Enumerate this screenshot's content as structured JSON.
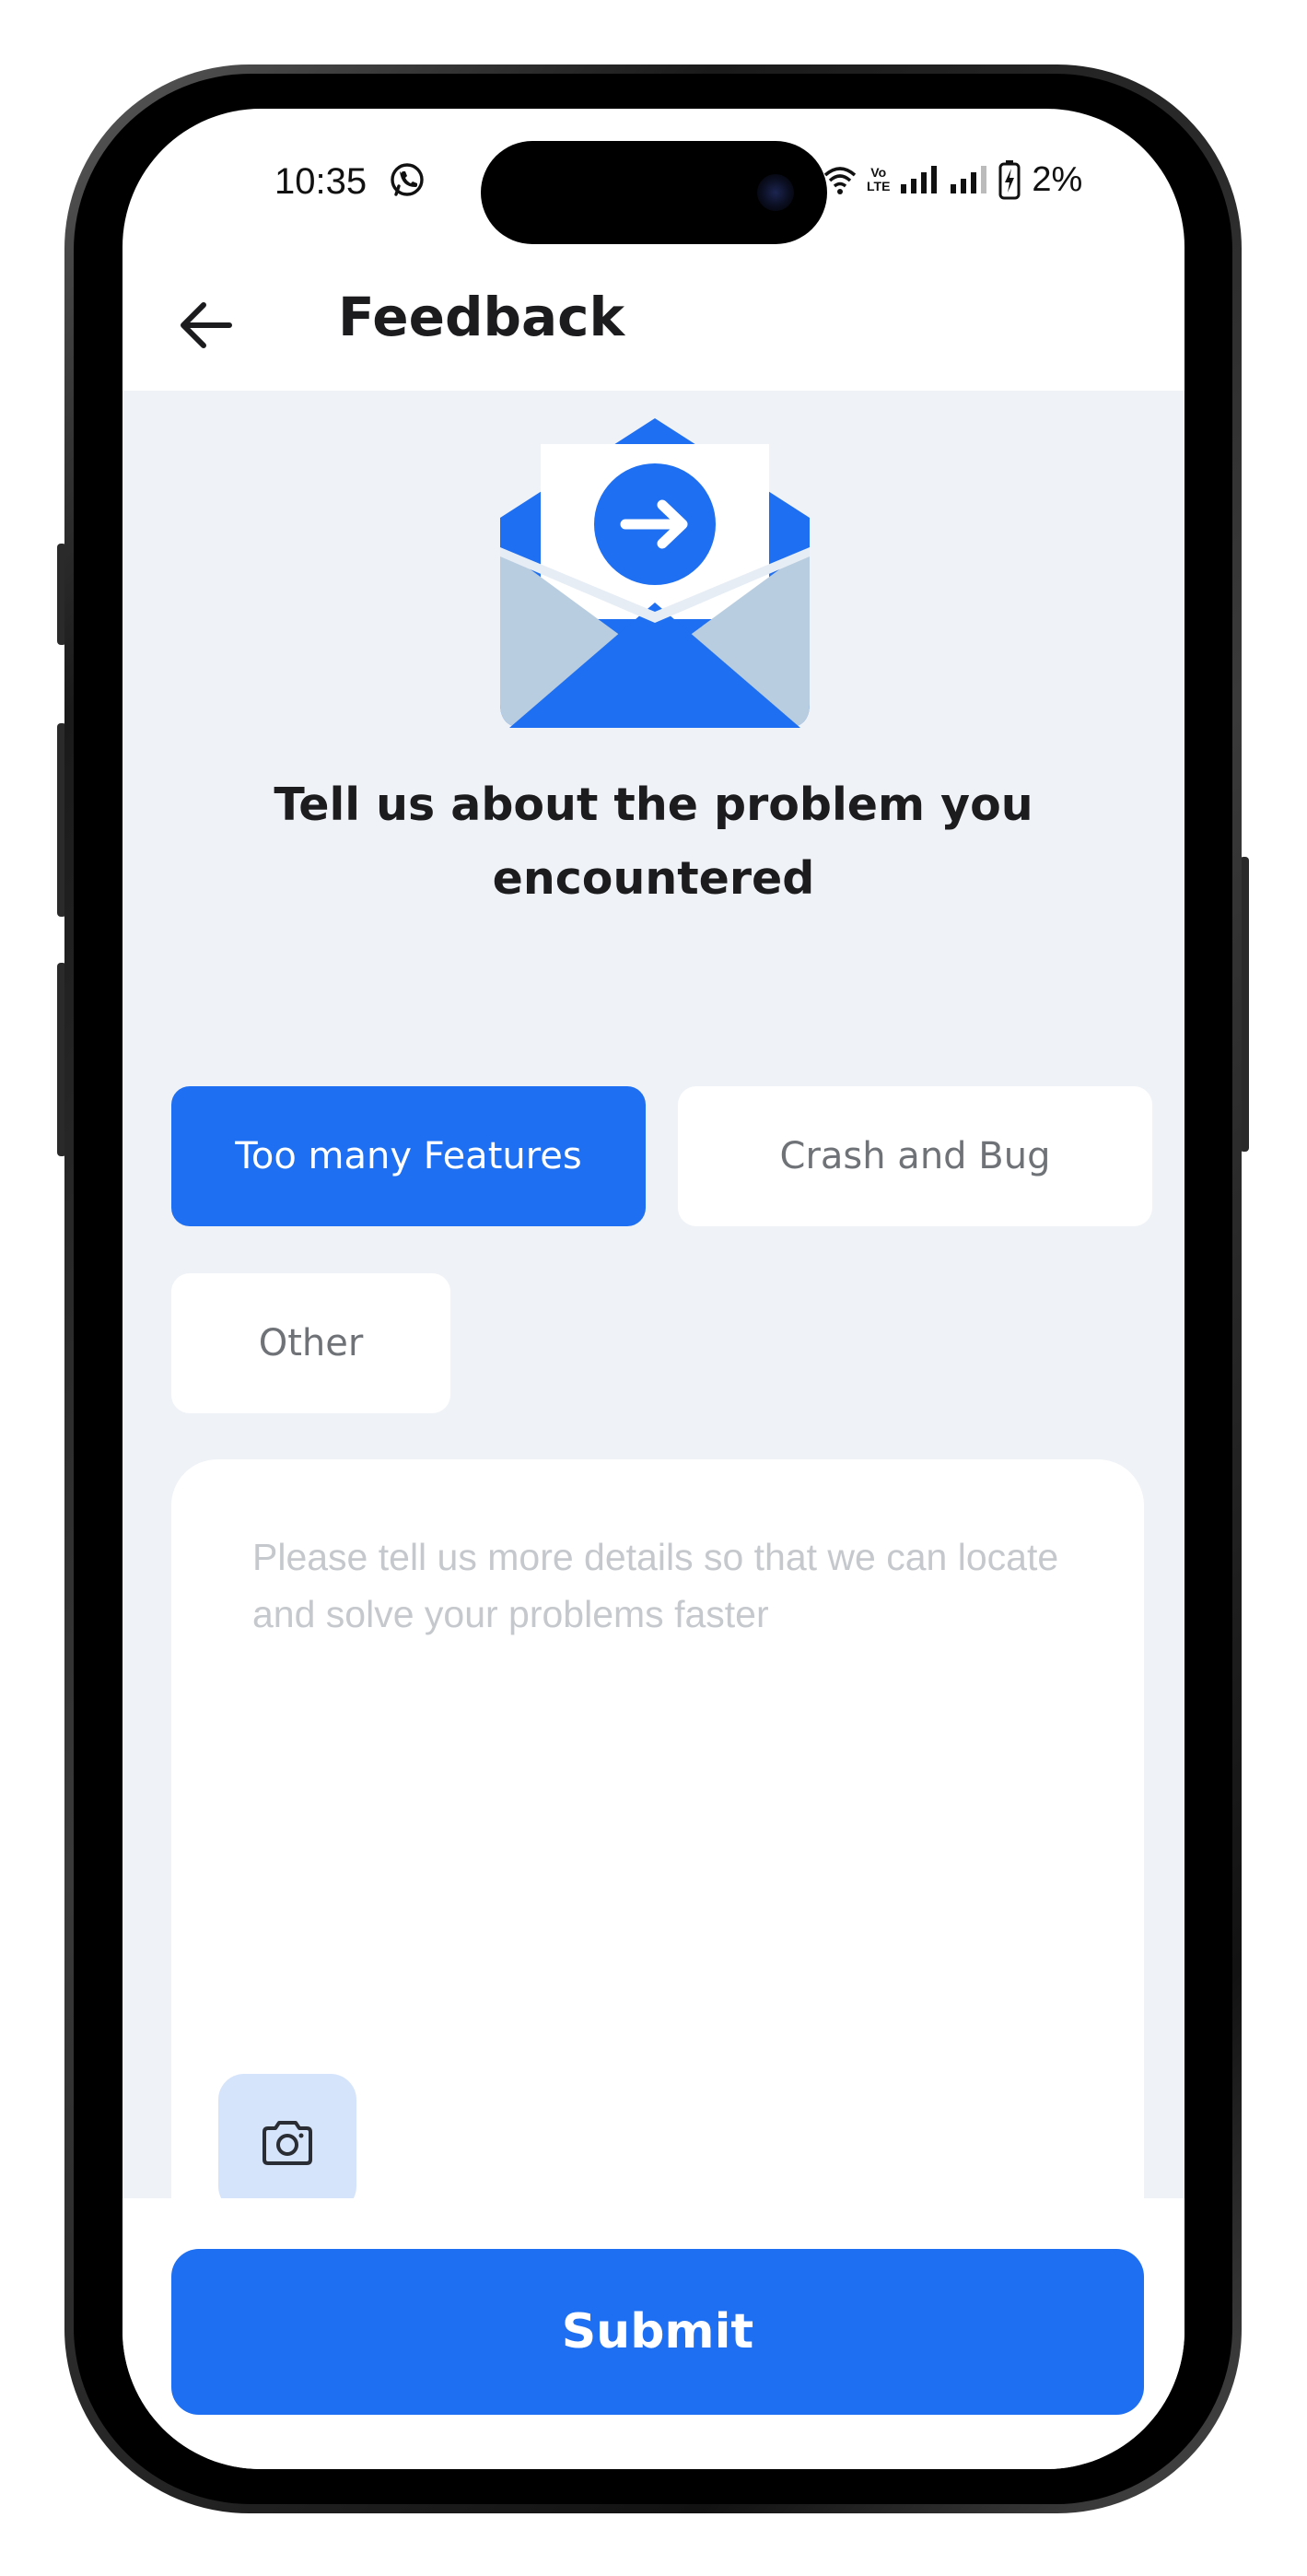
{
  "status_bar": {
    "time": "10:35",
    "battery_percent": "2%",
    "network_label_top": "Vo",
    "network_label_bottom": "LTE",
    "icons": [
      "whatsapp-icon",
      "wifi-icon",
      "volte-icon",
      "signal-1-icon",
      "signal-2-icon",
      "battery-charging-icon"
    ]
  },
  "header": {
    "title": "Feedback",
    "back_icon": "arrow-left-icon"
  },
  "illustration": {
    "icon": "envelope-arrow-icon",
    "colors": {
      "primary": "#1e6ff1",
      "flap": "#b9cde0",
      "paper": "#ffffff"
    }
  },
  "prompt": {
    "heading": "Tell us about the problem you encountered"
  },
  "categories": [
    {
      "label": "Too many Features",
      "selected": true
    },
    {
      "label": "Crash and Bug",
      "selected": false
    },
    {
      "label": "Other",
      "selected": false
    }
  ],
  "details": {
    "value": "",
    "placeholder": "Please tell us more details so that we can locate and solve your problems faster",
    "camera_icon": "camera-icon"
  },
  "footer": {
    "submit_label": "Submit"
  },
  "colors": {
    "accent": "#1e6ff1",
    "background": "#eff2f6",
    "chip_text": "#6f7378",
    "placeholder": "#c5c8cc",
    "camera_bg": "#d6e4fb"
  }
}
